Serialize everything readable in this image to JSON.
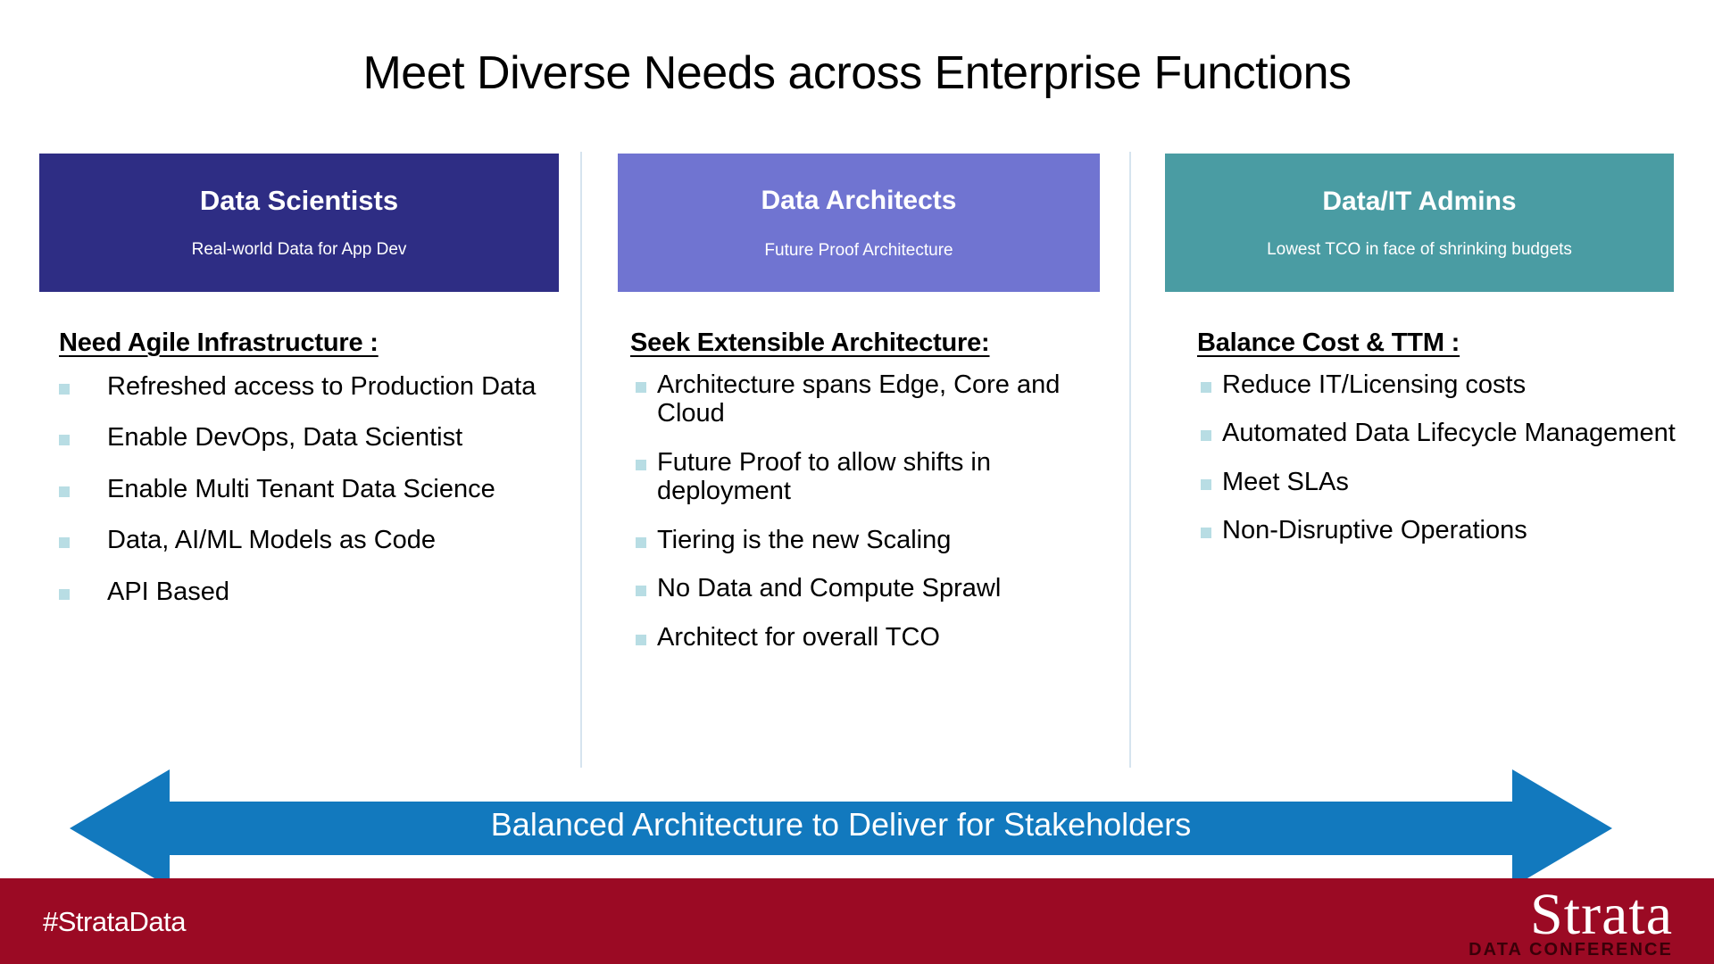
{
  "slide": {
    "title": "Meet Diverse Needs across Enterprise Functions"
  },
  "personas": [
    {
      "title": "Data Scientists",
      "subtitle": "Real-world Data for App Dev",
      "color": "#2E2D84"
    },
    {
      "title": "Data Architects",
      "subtitle": "Future Proof Architecture",
      "color": "#7074D1"
    },
    {
      "title": "Data/IT Admins",
      "subtitle": "Lowest TCO in face of shrinking budgets",
      "color": "#4A9CA3"
    }
  ],
  "columns": [
    {
      "heading": "Need Agile Infrastructure :",
      "bullets": [
        "Refreshed access to Production Data",
        "Enable DevOps, Data Scientist",
        "Enable Multi Tenant Data Science",
        "Data, AI/ML Models as Code",
        "API Based"
      ]
    },
    {
      "heading": "Seek Extensible Architecture:",
      "bullets": [
        "Architecture spans Edge, Core and Cloud",
        "Future Proof to allow shifts in deployment",
        "Tiering is the new Scaling",
        "No Data and Compute Sprawl",
        "Architect for overall TCO"
      ]
    },
    {
      "heading": "Balance Cost & TTM :",
      "bullets": [
        "Reduce IT/Licensing costs",
        "Automated Data Lifecycle Management",
        "Meet SLAs",
        "Non-Disruptive Operations"
      ]
    }
  ],
  "banner": {
    "label": "Balanced Architecture to Deliver for Stakeholders",
    "color": "#1279BE"
  },
  "footer": {
    "hashtag": "#StrataData",
    "logo_word": "Strata",
    "logo_sub": "DATA CONFERENCE",
    "color": "#9B0A24"
  },
  "theme": {
    "bullet_marker_color": "#B8DDE4",
    "divider_color": "#D6E4EF"
  }
}
